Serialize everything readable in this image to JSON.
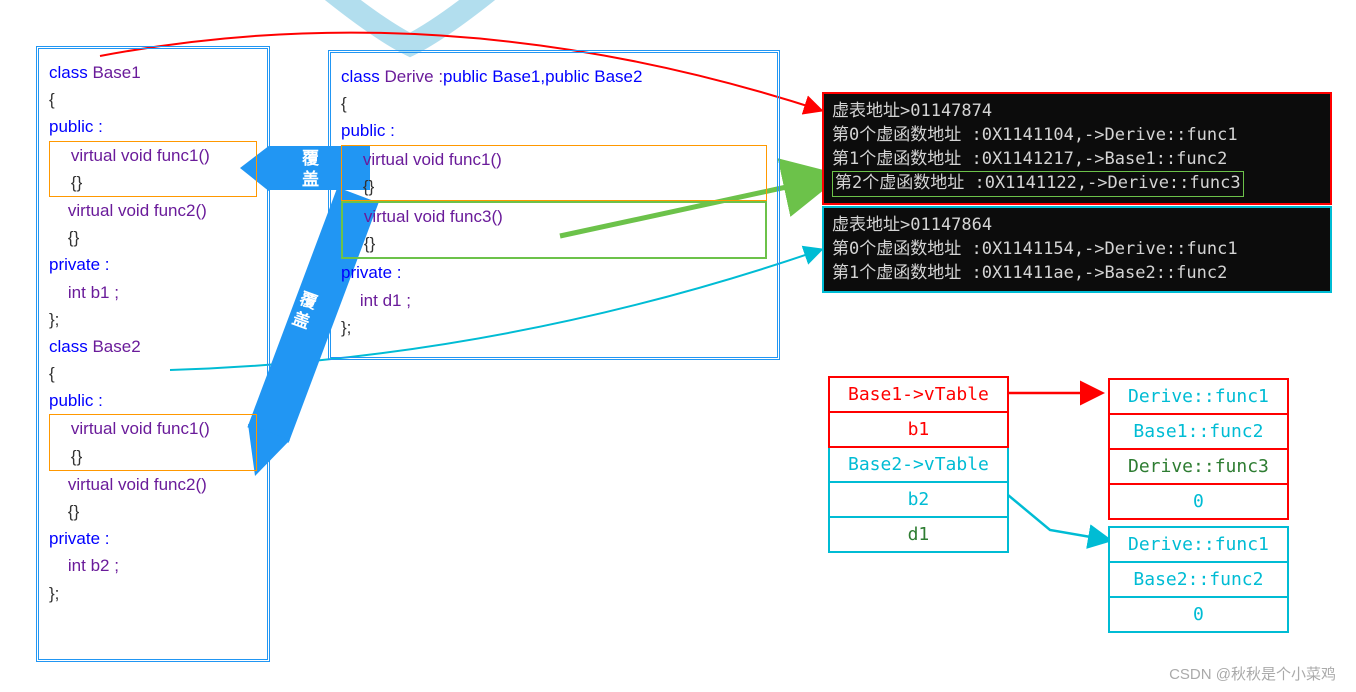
{
  "base1": {
    "class_kw": "class ",
    "name": "Base1",
    "lbrace": "{",
    "public": "public :",
    "func1_sig": "    virtual void func1()",
    "func1_body": "    {}",
    "func2_sig": "    virtual void func2()",
    "func2_body": "    {}",
    "private": "private :",
    "member": "    int b1 ;",
    "rbrace": "};"
  },
  "base2": {
    "class_kw": "class ",
    "name": "Base2",
    "lbrace": "{",
    "public": "public :",
    "func1_sig": "    virtual void func1()",
    "func1_body": "    {}",
    "func2_sig": "    virtual void func2()",
    "func2_body": "    {}",
    "private": "private :",
    "member": "    int b2 ;",
    "rbrace": "};"
  },
  "derive": {
    "class_kw": "class ",
    "name": "Derive :",
    "inherit": "public Base1,public Base2",
    "lbrace": "{",
    "public": "public :",
    "func1_sig": "    virtual void func1()",
    "func1_body": "    {}",
    "func3_sig": "    virtual void func3()",
    "func3_body": "    {}",
    "private": "private :",
    "member": "    int d1 ;",
    "rbrace": "};"
  },
  "console1": {
    "l0": "虚表地址>01147874",
    "l1": "第0个虚函数地址 :0X1141104,->Derive::func1",
    "l2": "第1个虚函数地址 :0X1141217,->Base1::func2",
    "l3": "第2个虚函数地址 :0X1141122,->Derive::func3"
  },
  "console2": {
    "l0": "虚表地址>01147864",
    "l1": "第0个虚函数地址 :0X1141154,->Derive::func1",
    "l2": "第1个虚函数地址 :0X11411ae,->Base2::func2"
  },
  "layout": {
    "row0": "Base1->vTable",
    "row1": "b1",
    "row2": "Base2->vTable",
    "row3": "b2",
    "row4": "d1"
  },
  "vt1": {
    "r0": "Derive::func1",
    "r1": "Base1::func2",
    "r2": "Derive::func3",
    "r3": "0"
  },
  "vt2": {
    "r0": "Derive::func1",
    "r1": "Base2::func2",
    "r2": "0"
  },
  "arrow_label1": "覆盖",
  "arrow_label2": "覆盖",
  "watermark": "CSDN @秋秋是个小菜鸡"
}
